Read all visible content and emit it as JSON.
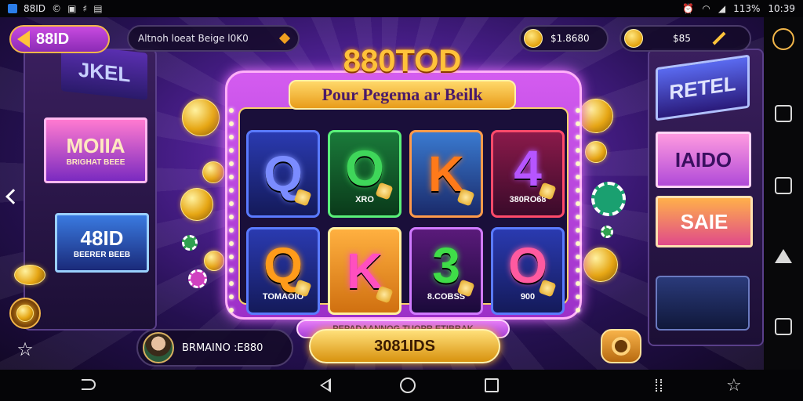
{
  "status_bar": {
    "app_name": "88ID",
    "battery": "113%",
    "time": "10:39"
  },
  "header": {
    "back_label": "88ID",
    "search_text": "Altnoh loeat Beige l0K0",
    "balance_1": "$1.8680",
    "balance_2": "$85"
  },
  "title": {
    "main": "880TOD",
    "ribbon": "Pour Pegema ar Beilk"
  },
  "machines": {
    "left_1": "JKEL",
    "left_2_big": "MOIIA",
    "left_2_small": "BRIGHAT BEEE",
    "left_3_big": "48ID",
    "left_3_small": "BEERER BEEB",
    "right_1": "RETEL",
    "right_2": "IAIDO",
    "right_3": "SAIE"
  },
  "reels": [
    {
      "symbol": "Q",
      "caption": "",
      "color": "#7b8cff"
    },
    {
      "symbol": "O",
      "caption": "XRO",
      "color": "#3fd65a"
    },
    {
      "symbol": "K",
      "caption": "",
      "color": "#ff7a1a"
    },
    {
      "symbol": "4",
      "caption": "380RO68",
      "color": "#b655ff"
    },
    {
      "symbol": "Q",
      "caption": "TOMAOIO",
      "color": "#ff9b1a"
    },
    {
      "symbol": "K",
      "caption": "",
      "color": "#ff4fc0"
    },
    {
      "symbol": "3",
      "caption": "8.COBSS",
      "color": "#3fdd48"
    },
    {
      "symbol": "O",
      "caption": "900",
      "color": "#ff5aa0"
    }
  ],
  "bottom_ribbon": "PEPADAANNOG TUOPR ETIBRAK",
  "player": {
    "name": "BRMAINO :E880"
  },
  "spin": {
    "label": "3081IDS"
  },
  "colors": {
    "bg_purple": "#4b1f8e",
    "gold": "#ffc23a",
    "frame_pink": "#d45cf0"
  }
}
